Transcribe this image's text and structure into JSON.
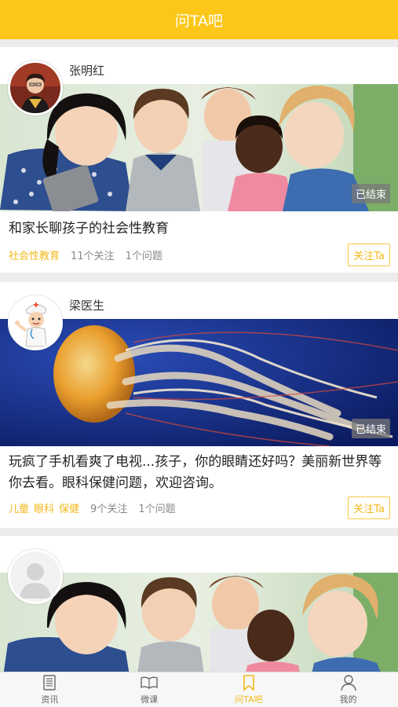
{
  "header": {
    "title": "问TA吧"
  },
  "cards": [
    {
      "author": "张明红",
      "avatar_icon": "teacher-avatar",
      "status": "已结束",
      "title": "和家长聊孩子的社会性教育",
      "tag": "社会性教育",
      "followers": "11个关注",
      "questions": "1个问题",
      "follow_label": "关注Ta"
    },
    {
      "author": "梁医生",
      "avatar_icon": "doctor-cartoon-avatar",
      "status": "已结束",
      "title": "玩疯了手机看爽了电视...孩子，你的眼睛还好吗？美丽新世界等你去看。眼科保健问题，欢迎咨询。",
      "tags": [
        "儿童",
        "眼科",
        "保健"
      ],
      "followers": "9个关注",
      "questions": "1个问题",
      "follow_label": "关注Ta"
    },
    {
      "author": "",
      "avatar_icon": "default-avatar"
    }
  ],
  "tabbar": {
    "items": [
      {
        "label": "资讯",
        "icon": "newspaper-icon"
      },
      {
        "label": "微课",
        "icon": "open-book-icon"
      },
      {
        "label": "问TA吧",
        "icon": "bookmark-icon",
        "active": true
      },
      {
        "label": "我的",
        "icon": "person-icon"
      }
    ]
  },
  "colors": {
    "accent": "#fcc719",
    "tag": "#f2b91b",
    "text": "#222222"
  }
}
